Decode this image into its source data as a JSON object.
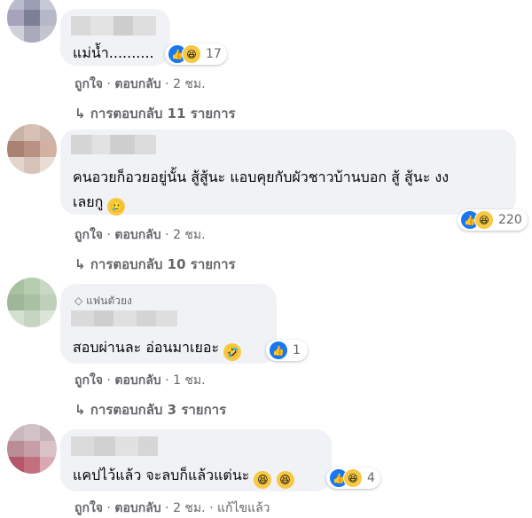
{
  "comments": [
    {
      "text": "แม่น้ำ..........",
      "reaction_count": "17",
      "like_label": "ถูกใจ",
      "reply_label": "ตอบกลับ",
      "time": "2 ชม.",
      "replies_label": "การตอบกลับ 11 รายการ"
    },
    {
      "text_line1": "คนอวยก็อวยอยู่นั้น สู้สู้นะ แอบคุยกับผัวชาวบ้านบอก สู้ สู้นะ งง",
      "text_line2": "เลยกู",
      "reaction_count": "220",
      "like_label": "ถูกใจ",
      "reply_label": "ตอบกลับ",
      "time": "2 ชม.",
      "replies_label": "การตอบกลับ 10 รายการ"
    },
    {
      "badge": "แฟนตัวยง",
      "text": "สอบผ่านละ อ่อนมาเยอะ",
      "reaction_count": "1",
      "like_label": "ถูกใจ",
      "reply_label": "ตอบกลับ",
      "time": "1 ชม.",
      "replies_label": "การตอบกลับ 3 รายการ"
    },
    {
      "text": "แคปไว้แล้ว จะลบก็แล้วแต่นะ",
      "reaction_count": "4",
      "like_label": "ถูกใจ",
      "reply_label": "ตอบกลับ",
      "time": "2 ชม.",
      "edited_label": "แก้ไขแล้ว"
    }
  ],
  "separator": "·",
  "icons": {
    "like": "like-reaction-icon",
    "haha": "haha-reaction-icon",
    "reply_arrow": "reply-arrow-icon",
    "diamond": "diamond-badge-icon"
  },
  "colors": {
    "bubble": "#f0f2f5",
    "like": "#1877f2",
    "haha": "#f7c843",
    "meta": "#65676b"
  }
}
